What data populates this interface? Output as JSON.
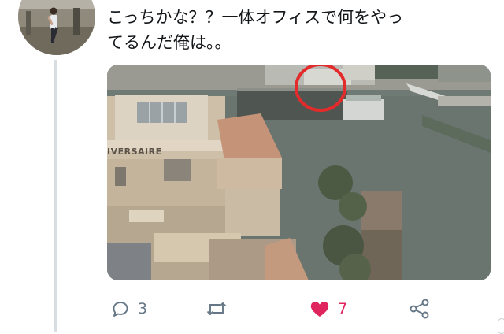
{
  "tweet": {
    "text_line1": "こっちかな？？一体オフィスで何をやっ",
    "text_line2": "てるんだ俺は。。"
  },
  "media": {
    "building_sign": "IVERSAIRE"
  },
  "actions": {
    "reply_count": "3",
    "retweet_count": "",
    "like_count": "7",
    "liked": true
  },
  "colors": {
    "text": "#14171a",
    "gray": "#657786",
    "like": "#e0245e",
    "thread_line": "#d8dde2"
  },
  "icons": [
    "reply-icon",
    "retweet-icon",
    "heart-icon",
    "share-icon"
  ]
}
